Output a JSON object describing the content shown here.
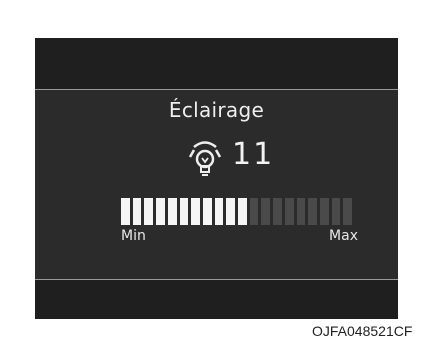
{
  "display": {
    "title": "Éclairage",
    "icon": "illumination-icon",
    "level": "11",
    "level_value": 11,
    "level_max": 20,
    "min_label": "Min",
    "max_label": "Max",
    "colors": {
      "screen_background": "#2b2b2b",
      "bar_background": "#1f1f1f",
      "segment_on": "#f5f5f5",
      "segment_off": "#4a4a4a"
    }
  },
  "figure_code": "OJFA048521CF"
}
